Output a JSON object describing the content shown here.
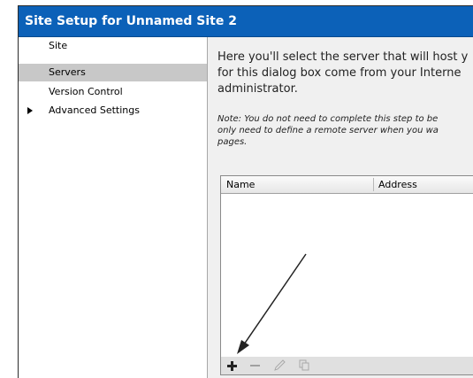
{
  "window": {
    "title": "Site Setup for Unnamed Site 2"
  },
  "sidebar": {
    "items": [
      {
        "label": "Site",
        "selected": false
      },
      {
        "label": "Servers",
        "selected": true
      },
      {
        "label": "Version Control",
        "selected": false
      },
      {
        "label": "Advanced Settings",
        "selected": false,
        "expandable": true
      }
    ]
  },
  "content": {
    "intro": "Here you'll select the server that will host y\nfor this dialog box come from your Interne\nadministrator.",
    "note": "Note: You do not need to complete this step to be\nonly need to define a remote server when you wa\npages."
  },
  "server_table": {
    "columns": [
      "Name",
      "Address"
    ],
    "rows": []
  },
  "toolbar": {
    "icons": [
      "add-server-icon",
      "remove-server-icon",
      "edit-server-icon",
      "duplicate-server-icon"
    ]
  },
  "colors": {
    "titlebar": "#0c61b8",
    "selection": "#c8c8c8"
  }
}
